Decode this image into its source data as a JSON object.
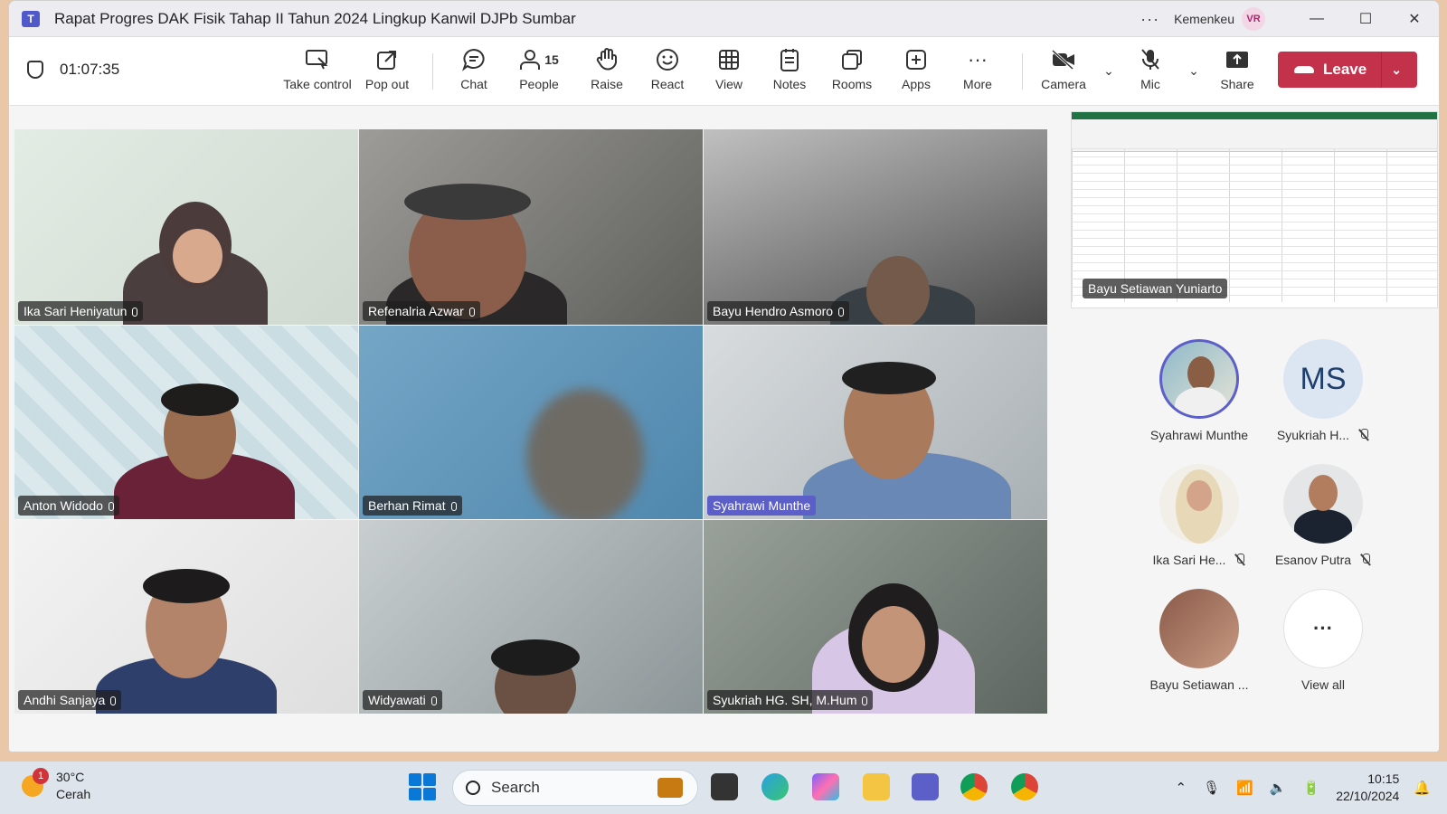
{
  "window": {
    "title": "Rapat Progres DAK Fisik Tahap II Tahun 2024 Lingkup Kanwil DJPb Sumbar",
    "org": "Kemenkeu",
    "user_initials": "VR"
  },
  "toolbar": {
    "timer": "01:07:35",
    "buttons": {
      "take_control": "Take control",
      "pop_out": "Pop out",
      "chat": "Chat",
      "people": "People",
      "people_count": "15",
      "raise": "Raise",
      "react": "React",
      "view": "View",
      "notes": "Notes",
      "rooms": "Rooms",
      "apps": "Apps",
      "more": "More",
      "camera": "Camera",
      "mic": "Mic",
      "share": "Share"
    },
    "leave_label": "Leave",
    "leave_color": "#c4314b"
  },
  "participants": [
    {
      "name": "Ika Sari Heniyatun"
    },
    {
      "name": "Refenalria Azwar"
    },
    {
      "name": "Bayu Hendro Asmoro"
    },
    {
      "name": "Anton Widodo"
    },
    {
      "name": "Berhan Rimat"
    },
    {
      "name": "Syahrawi Munthe"
    },
    {
      "name": "Andhi Sanjaya"
    },
    {
      "name": "Widyawati"
    },
    {
      "name": "Syukriah HG. SH, M.Hum"
    }
  ],
  "screen_share": {
    "presenter": "Bayu Setiawan Yuniarto"
  },
  "roster": [
    {
      "name": "Syahrawi Munthe",
      "muted": false,
      "speaking": true
    },
    {
      "name": "Syukriah H...",
      "initials": "MS",
      "muted": true
    },
    {
      "name": "Ika Sari He...",
      "muted": true
    },
    {
      "name": "Esanov Putra",
      "muted": true
    },
    {
      "name": "Bayu Setiawan ...",
      "muted": false
    },
    {
      "name": "View all",
      "icon": "more-icon"
    }
  ],
  "taskbar": {
    "weather_temp": "30°C",
    "weather_desc": "Cerah",
    "weather_badge": "1",
    "search_placeholder": "Search",
    "time": "10:15",
    "date": "22/10/2024"
  }
}
